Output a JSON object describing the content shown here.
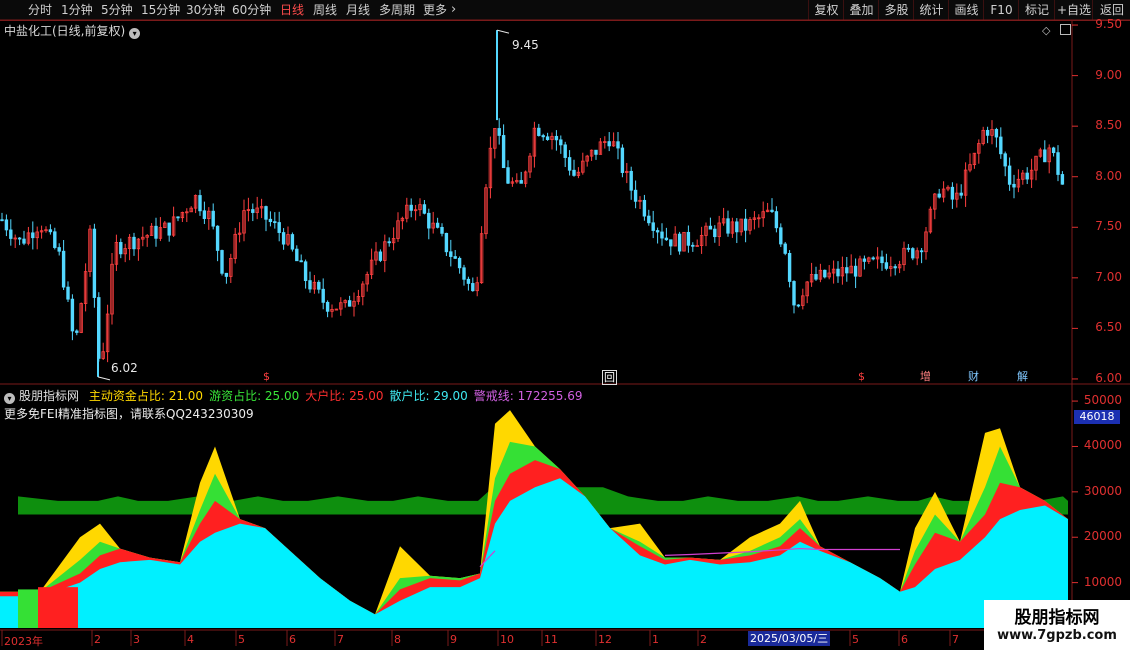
{
  "toolbar": {
    "periods": [
      {
        "label": "分时"
      },
      {
        "label": "1分钟"
      },
      {
        "label": "5分钟"
      },
      {
        "label": "15分钟"
      },
      {
        "label": "30分钟"
      },
      {
        "label": "60分钟"
      },
      {
        "label": "日线",
        "active": true
      },
      {
        "label": "周线"
      },
      {
        "label": "月线"
      },
      {
        "label": "多周期"
      },
      {
        "label": "更多"
      }
    ],
    "more_arrow": "›",
    "right_buttons": [
      "复权",
      "叠加",
      "多股",
      "统计",
      "画线",
      "F10",
      "标记",
      "+自选",
      "返回"
    ]
  },
  "stock": {
    "title": "中盐化工(日线,前复权)",
    "high_label": "9.45",
    "low_label": "6.02",
    "axis": [
      "9.50",
      "9.00",
      "8.50",
      "8.00",
      "7.50",
      "7.00",
      "6.50",
      "6.00"
    ]
  },
  "events": [
    {
      "label": "$",
      "color": "#ff4040"
    },
    {
      "label": "回",
      "color": "#ffffff"
    },
    {
      "label": "$",
      "color": "#ff4040"
    },
    {
      "label": "增",
      "color": "#ff8080"
    },
    {
      "label": "财",
      "color": "#80c8ff"
    },
    {
      "label": "解",
      "color": "#80c8ff"
    }
  ],
  "indicator": {
    "name": "股朋指标网",
    "items": [
      {
        "text": "主动资金占比: 21.00",
        "color": "#ffd800"
      },
      {
        "text": "游资占比: 25.00",
        "color": "#39e639"
      },
      {
        "text": "大户比: 25.00",
        "color": "#ff3030"
      },
      {
        "text": "散户比: 29.00",
        "color": "#3fe8f0"
      },
      {
        "text": "警戒线: 172255.69",
        "color": "#d060e0"
      }
    ],
    "contact": "更多免FEI精准指标图，请联系QQ243230309",
    "current_value": "46018",
    "axis": [
      "50000",
      "40000",
      "30000",
      "20000",
      "10000"
    ]
  },
  "timeline": {
    "labels": [
      "2023年",
      "2",
      "3",
      "4",
      "5",
      "6",
      "7",
      "8",
      "9",
      "10",
      "11",
      "12",
      "1",
      "2",
      "5",
      "6",
      "7"
    ],
    "date_box": "2025/03/05/三"
  },
  "watermark": {
    "line1": "股朋指标网",
    "line2": "www.7gpzb.com"
  },
  "colors": {
    "up": "#ff4040",
    "down": "#54d8ff",
    "yellow": "#ffd800",
    "green": "#35e035",
    "red": "#ff2020",
    "cyan": "#00f0ff",
    "dark_green": "#0e8f0e",
    "alert": "#d040d0"
  },
  "chart_data": [
    {
      "type": "line",
      "title": "中盐化工(日线,前复权)",
      "ylim": [
        5.95,
        9.55
      ],
      "x": [
        0,
        20,
        40,
        60,
        75,
        90,
        100,
        115,
        140,
        170,
        195,
        210,
        225,
        245,
        265,
        285,
        305,
        325,
        345,
        365,
        390,
        415,
        440,
        460,
        475,
        485,
        495,
        505,
        520,
        535,
        555,
        575,
        590,
        610,
        630,
        650,
        665,
        680,
        700,
        720,
        745,
        770,
        785,
        795,
        805,
        820,
        840,
        860,
        880,
        900,
        920,
        940,
        955,
        975,
        985,
        995,
        1010,
        1030,
        1050,
        1065
      ],
      "values": [
        7.6,
        7.35,
        7.55,
        7.2,
        6.3,
        7.4,
        6.05,
        7.3,
        7.4,
        7.5,
        7.8,
        7.6,
        7.0,
        7.7,
        7.6,
        7.4,
        7.0,
        6.75,
        6.7,
        7.0,
        7.4,
        7.75,
        7.4,
        7.1,
        6.8,
        7.9,
        8.55,
        8.0,
        7.85,
        8.5,
        8.4,
        8.0,
        8.2,
        8.4,
        7.9,
        7.6,
        7.4,
        7.35,
        7.4,
        7.5,
        7.5,
        7.65,
        7.3,
        6.7,
        6.95,
        7.0,
        7.05,
        7.1,
        7.15,
        7.2,
        7.3,
        7.9,
        7.75,
        8.2,
        8.5,
        8.4,
        7.95,
        8.05,
        8.3,
        7.85
      ],
      "high": {
        "x": 497,
        "value": 9.45
      },
      "low": {
        "x": 98,
        "value": 6.02
      }
    },
    {
      "type": "area",
      "ylim": [
        0,
        52000
      ],
      "x": [
        0,
        40,
        80,
        100,
        120,
        150,
        180,
        200,
        215,
        240,
        265,
        290,
        320,
        350,
        375,
        400,
        430,
        460,
        480,
        495,
        510,
        535,
        560,
        585,
        610,
        640,
        665,
        690,
        720,
        750,
        780,
        800,
        820,
        850,
        880,
        900,
        915,
        935,
        960,
        985,
        1000,
        1020,
        1045,
        1068
      ],
      "series": [
        {
          "name": "散户比",
          "values": [
            7000,
            7000,
            10000,
            13000,
            14500,
            15000,
            14000,
            19000,
            21000,
            23000,
            22000,
            17000,
            11000,
            6000,
            3000,
            6000,
            9000,
            9000,
            11000,
            23000,
            28000,
            31000,
            33000,
            29000,
            22000,
            16000,
            14000,
            15000,
            14000,
            14500,
            16000,
            19000,
            17000,
            14500,
            11000,
            8000,
            9000,
            13000,
            15000,
            20000,
            24000,
            26000,
            27000,
            24000
          ]
        },
        {
          "name": "大户比",
          "values": [
            8000,
            8000,
            12000,
            16000,
            17500,
            15500,
            14500,
            23000,
            28000,
            24000,
            22000,
            17000,
            11000,
            6000,
            3000,
            8500,
            11000,
            10500,
            12000,
            28000,
            34000,
            37000,
            35000,
            29000,
            22000,
            18000,
            15000,
            15500,
            15000,
            16000,
            18000,
            22000,
            18000,
            14500,
            11000,
            8000,
            14000,
            21000,
            19000,
            25000,
            32000,
            31000,
            28000,
            24000
          ]
        },
        {
          "name": "游资占比",
          "values": [
            8000,
            8000,
            15000,
            19000,
            17500,
            15500,
            14500,
            26000,
            34000,
            24000,
            22000,
            17000,
            11000,
            6000,
            3000,
            11000,
            11500,
            11000,
            12000,
            33000,
            41000,
            40000,
            35000,
            29000,
            22000,
            19000,
            15500,
            15500,
            15000,
            17000,
            20000,
            24000,
            18000,
            14500,
            11000,
            8000,
            17000,
            25000,
            19000,
            31000,
            40000,
            31000,
            28000,
            24000
          ]
        },
        {
          "name": "主动资金占比",
          "values": [
            8000,
            8000,
            20000,
            23000,
            17500,
            15500,
            14500,
            32000,
            40000,
            24000,
            22000,
            17000,
            11000,
            6000,
            3000,
            18000,
            11500,
            11000,
            12000,
            45000,
            48000,
            40000,
            35000,
            29000,
            22000,
            23000,
            15500,
            15500,
            15000,
            20000,
            23000,
            28000,
            18000,
            14500,
            11000,
            8000,
            22000,
            30000,
            19000,
            43000,
            44000,
            31000,
            28000,
            24000
          ]
        },
        {
          "name": "警戒线",
          "values": [
            null,
            null,
            null,
            null,
            null,
            null,
            null,
            null,
            null,
            null,
            null,
            null,
            null,
            null,
            null,
            null,
            null,
            null,
            13500,
            17000,
            null,
            null,
            null,
            null,
            null,
            null,
            16000,
            16200,
            16500,
            16800,
            17200,
            17500,
            17300,
            17300,
            17300,
            17300,
            null,
            null,
            null,
            null,
            null,
            null,
            null,
            null
          ]
        }
      ]
    }
  ]
}
